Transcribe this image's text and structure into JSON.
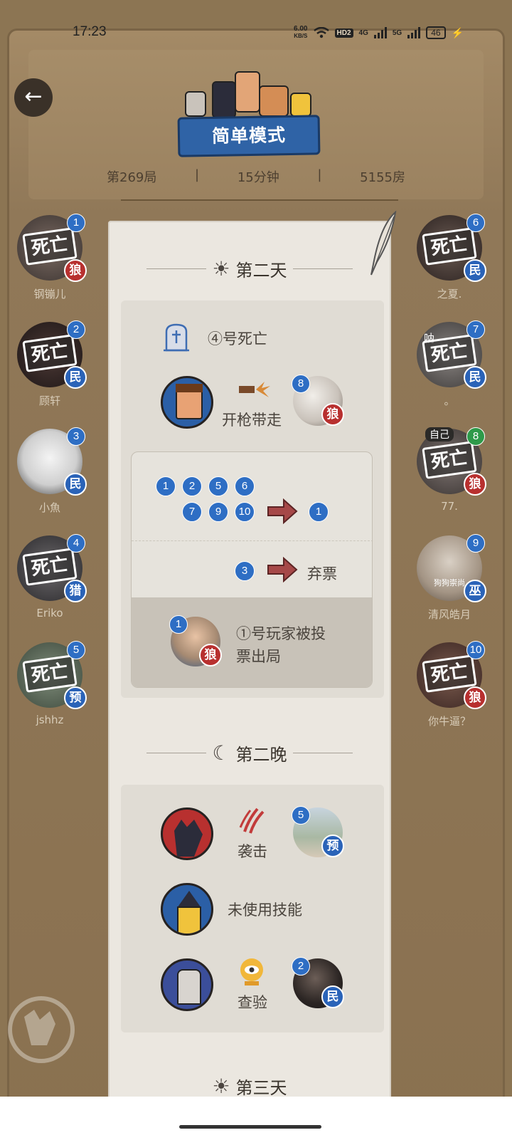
{
  "status": {
    "time": "17:23",
    "speed_value": "6.00",
    "speed_unit": "KB/S",
    "hd_label": "HD2",
    "net1": "4G",
    "net2": "5G",
    "battery": "46"
  },
  "header": {
    "mode": "简单模式",
    "game_number": "第269局",
    "duration": "15分钟",
    "room": "5155房",
    "back_icon": "back-arrow-icon"
  },
  "seats_left": [
    {
      "num": "1",
      "name": "钢镚儿",
      "dead": "死亡",
      "badge": "狼",
      "badge_type": "wolf"
    },
    {
      "num": "2",
      "name": "顾轩",
      "dead": "死亡",
      "badge": "民",
      "badge_type": "blue"
    },
    {
      "num": "3",
      "name": "小魚",
      "dead": "",
      "badge": "民",
      "badge_type": "blue"
    },
    {
      "num": "4",
      "name": "Eriko",
      "dead": "死亡",
      "badge": "猎",
      "badge_type": "blue"
    },
    {
      "num": "5",
      "name": "jshhz",
      "dead": "死亡",
      "badge": "预",
      "badge_type": "blue"
    }
  ],
  "seats_right": [
    {
      "num": "6",
      "name": "之夏.",
      "dead": "死亡",
      "badge": "民",
      "badge_type": "blue"
    },
    {
      "num": "7",
      "name": "。",
      "dead": "死亡",
      "badge": "民",
      "badge_type": "blue",
      "overlay": "呐"
    },
    {
      "num": "8",
      "name": "77.",
      "dead": "死亡",
      "badge": "狼",
      "badge_type": "wolf",
      "self_tag": "自己"
    },
    {
      "num": "9",
      "name": "清风皓月",
      "dead": "",
      "badge": "巫",
      "badge_type": "blue",
      "caption": "狗狗崇尚"
    },
    {
      "num": "10",
      "name": "你牛逼？",
      "dead": "死亡",
      "badge": "狼",
      "badge_type": "wolf"
    }
  ],
  "day2": {
    "title": "第二天",
    "death_text": "④号死亡",
    "shoot_text": "开枪带走",
    "shoot_target_num": "8",
    "shoot_target_badge": "狼",
    "votes_group1_voters": [
      "1",
      "2",
      "5",
      "6",
      "7",
      "9",
      "10"
    ],
    "votes_group1_target": "1",
    "votes_group2_voter": "3",
    "votes_group2_result": "弃票",
    "out_num": "1",
    "out_badge": "狼",
    "out_text_line1": "①号玩家被投",
    "out_text_line2": "票出局"
  },
  "night2": {
    "title": "第二晚",
    "attack_text": "袭击",
    "attack_target_num": "5",
    "attack_target_badge": "预",
    "witch_text": "未使用技能",
    "check_text": "查验",
    "check_target_num": "2",
    "check_target_badge": "民"
  },
  "day3": {
    "title": "第三天"
  },
  "watermark": "狼人杀",
  "colors": {
    "background": "#8c7553",
    "paper": "#ebe7e0",
    "number_blue": "#2e6ec4",
    "wolf_red": "#b8302f"
  }
}
